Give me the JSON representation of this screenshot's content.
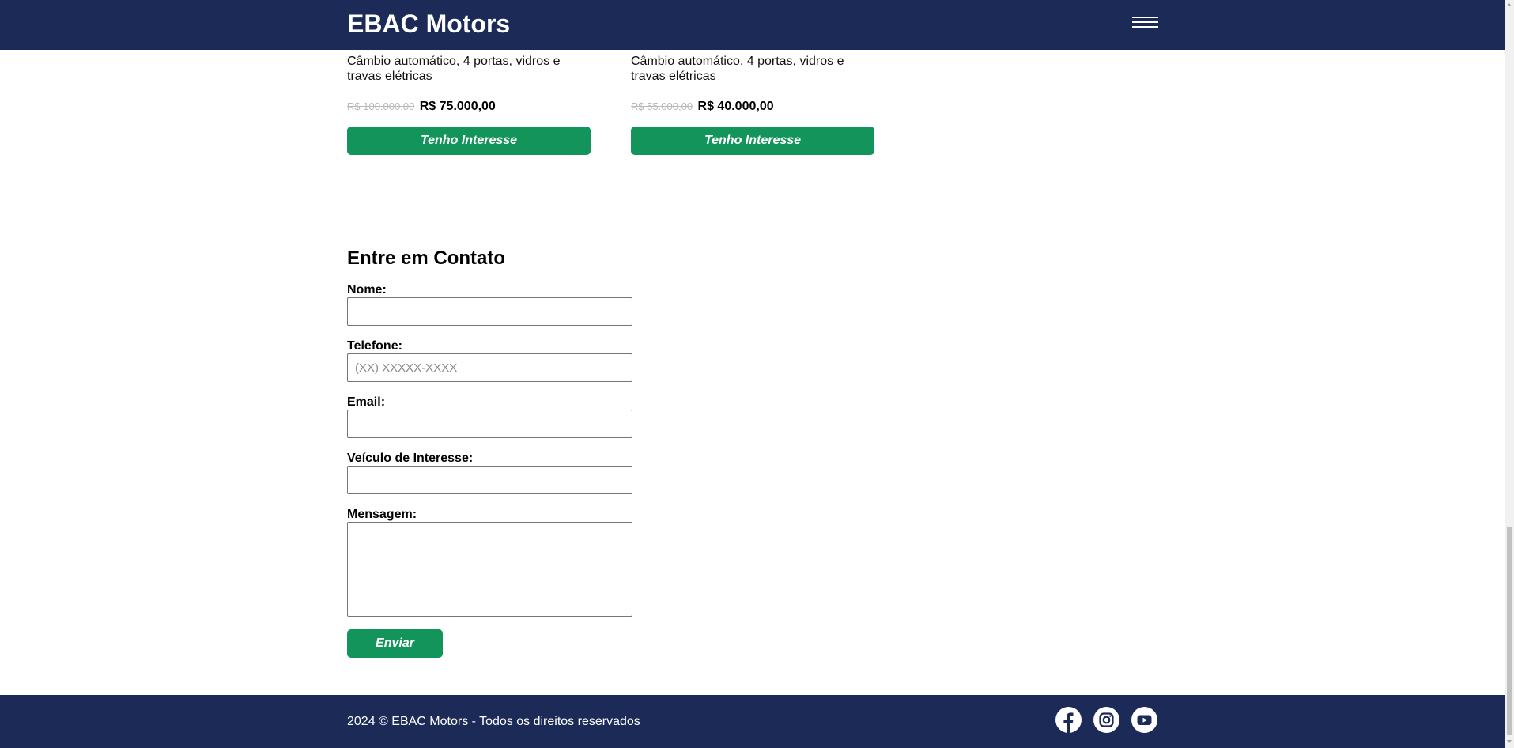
{
  "header": {
    "brand": "EBAC Motors",
    "menu_icon": "hamburger-menu-icon"
  },
  "cards": [
    {
      "description": "Câmbio automático, 4 portas, vidros e travas elétricas",
      "old_price": "R$ 100.000,00",
      "new_price": "R$ 75.000,00",
      "button_label": "Tenho Interesse"
    },
    {
      "description": "Câmbio automático, 4 portas, vidros e travas elétricas",
      "old_price": "R$ 55.000,00",
      "new_price": "R$ 40.000,00",
      "button_label": "Tenho Interesse"
    }
  ],
  "contact": {
    "title": "Entre em Contato",
    "name_label": "Nome:",
    "phone_label": "Telefone:",
    "phone_placeholder": "(XX) XXXXX-XXXX",
    "email_label": "Email:",
    "vehicle_label": "Veículo de Interesse:",
    "message_label": "Mensagem:",
    "submit_label": "Enviar"
  },
  "footer": {
    "copyright": "2024 © EBAC Motors - Todos os direitos reservados",
    "social": [
      "facebook-icon",
      "instagram-icon",
      "youtube-icon"
    ]
  },
  "colors": {
    "navy": "#1b2a57",
    "green": "#13945a"
  }
}
